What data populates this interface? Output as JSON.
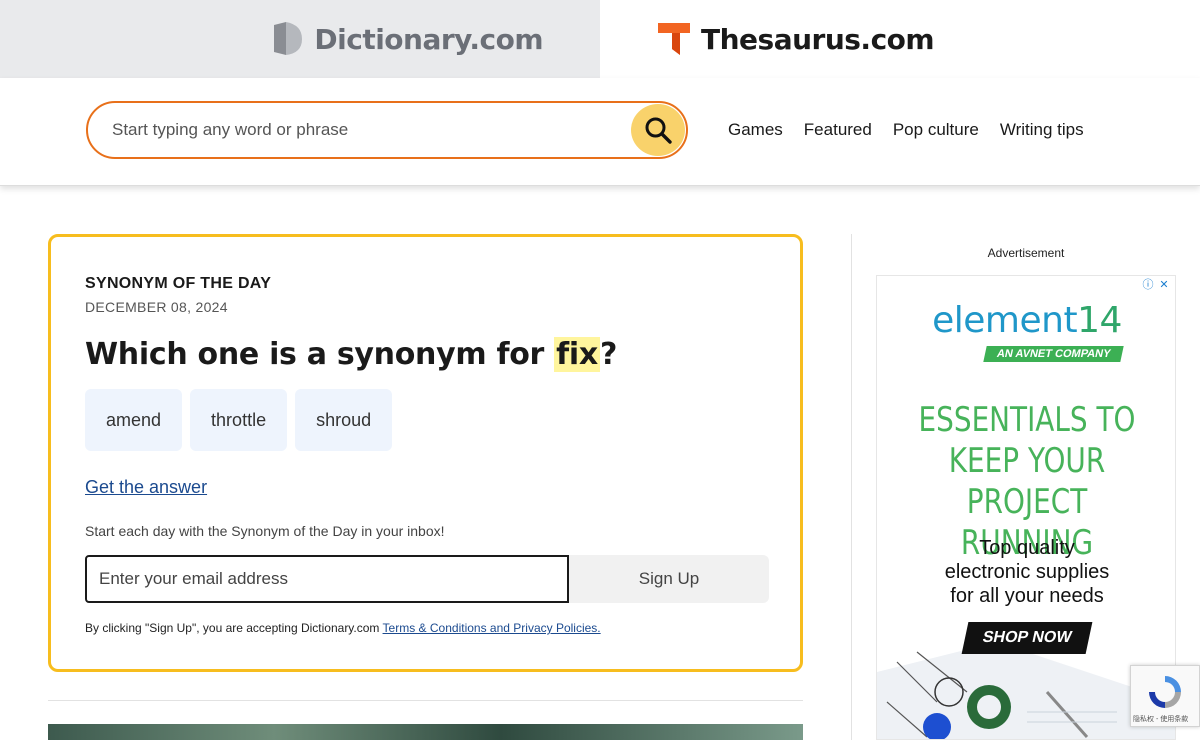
{
  "tabs": {
    "dictionary": "Dictionary.com",
    "thesaurus": "Thesaurus.com"
  },
  "search": {
    "placeholder": "Start typing any word or phrase"
  },
  "nav": {
    "items": [
      "Games",
      "Featured",
      "Pop culture",
      "Writing tips"
    ]
  },
  "synonym_card": {
    "eyebrow": "SYNONYM OF THE DAY",
    "date": "DECEMBER 08, 2024",
    "question_prefix": "Which one is a synonym for",
    "word": "fix",
    "question_suffix": "?",
    "options": [
      "amend",
      "throttle",
      "shroud"
    ],
    "answer_link": "Get the answer",
    "promo": "Start each day with the Synonym of the Day in your inbox!",
    "email_placeholder": "Enter your email address",
    "signup_label": "Sign Up",
    "terms_prefix": "By clicking \"Sign Up\", you are accepting Dictionary.com",
    "terms_link": "Terms & Conditions and Privacy Policies."
  },
  "ad": {
    "label": "Advertisement",
    "logo_text": "element",
    "logo_num": "14",
    "badge": "AN AVNET COMPANY",
    "headline_1": "ESSENTIALS TO",
    "headline_2": "KEEP YOUR",
    "headline_3": "PROJECT RUNNING",
    "sub_1": "Top quality",
    "sub_2": "electronic supplies",
    "sub_3": "for all your needs",
    "cta": "SHOP NOW"
  },
  "recaptcha": {
    "text": "隐私权 - 使用条款"
  },
  "colors": {
    "search_border": "#e8701a",
    "search_button": "#f9d26b",
    "card_border": "#f7bd1e",
    "highlight": "#fff59d",
    "link": "#1b4a8f",
    "thesaurus_logo": "#f26522"
  }
}
